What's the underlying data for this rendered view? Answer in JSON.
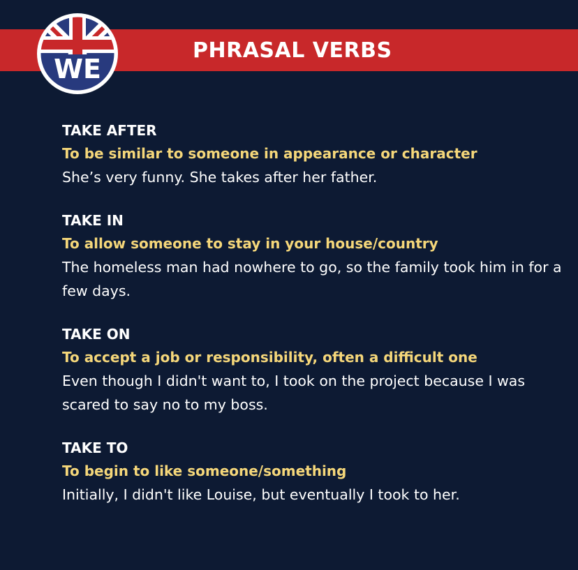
{
  "header": {
    "title": "PHRASAL VERBS",
    "logo_text": "WE",
    "colors": {
      "background": "#0d1a33",
      "banner": "#c8282a",
      "definition": "#f5d77a",
      "logo_navy": "#283a7e"
    }
  },
  "entries": [
    {
      "term": "TAKE AFTER",
      "definition": "To be similar to someone in appearance or character",
      "example": "She’s very funny. She takes after her father."
    },
    {
      "term": "TAKE IN",
      "definition": "To allow someone to stay in your house/country",
      "example": "The homeless man had nowhere to go, so the family took him in for a few days."
    },
    {
      "term": "TAKE ON",
      "definition": "To accept a job or responsibility, often a difficult one",
      "example": "Even though I didn't want to, I took on the project because I was scared to say no to my boss."
    },
    {
      "term": "TAKE TO",
      "definition": "To begin to like someone/something",
      "example": "Initially, I didn't like Louise, but eventually I took to her."
    }
  ]
}
